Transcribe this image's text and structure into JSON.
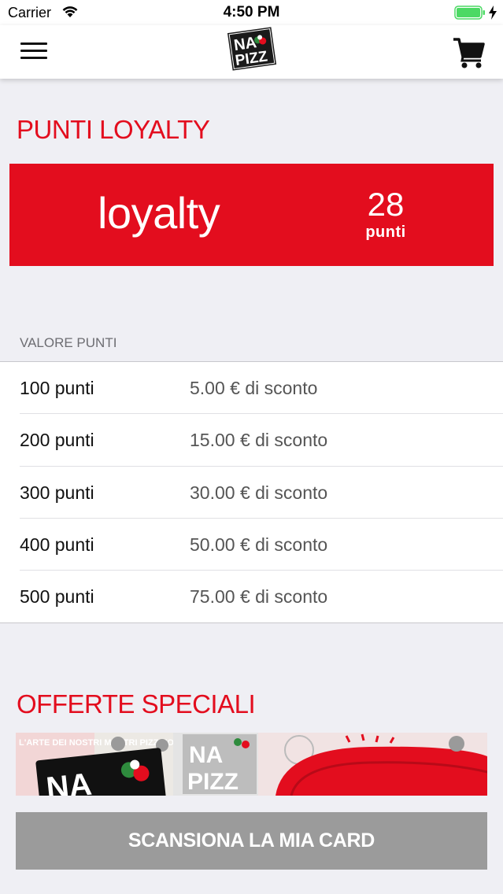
{
  "status_bar": {
    "carrier": "Carrier",
    "time": "4:50 PM"
  },
  "nav": {
    "logo_line1": "NA",
    "logo_line2": "PIZZ"
  },
  "loyalty": {
    "title": "PUNTI LOYALTY",
    "card_word": "loyalty",
    "points_value": "28",
    "points_unit": "punti",
    "card_color": "#e30d1e"
  },
  "points_table": {
    "header": "VALORE PUNTI",
    "rows": [
      {
        "points": "100 punti",
        "discount": "5.00 € di sconto"
      },
      {
        "points": "200 punti",
        "discount": "15.00 € di sconto"
      },
      {
        "points": "300 punti",
        "discount": "30.00 € di sconto"
      },
      {
        "points": "400 punti",
        "discount": "50.00 € di sconto"
      },
      {
        "points": "500 punti",
        "discount": "75.00 € di sconto"
      }
    ]
  },
  "offers": {
    "title": "OFFERTE SPECIALI",
    "banner_text_1": "L'ARTE DEI NOSTRI MASTRI PIZZAIOLI",
    "banner_logo_1": "NA",
    "banner_logo_2a": "NA",
    "banner_logo_2b": "PIZZ"
  },
  "scan_button": {
    "label": "SCANSIONA LA MIA CARD",
    "color": "#9b9b9b"
  },
  "colors": {
    "accent": "#e30d1e",
    "background": "#efeff4"
  },
  "icons": [
    "wifi-icon",
    "battery-icon",
    "charge-icon",
    "menu-icon",
    "cart-icon"
  ]
}
